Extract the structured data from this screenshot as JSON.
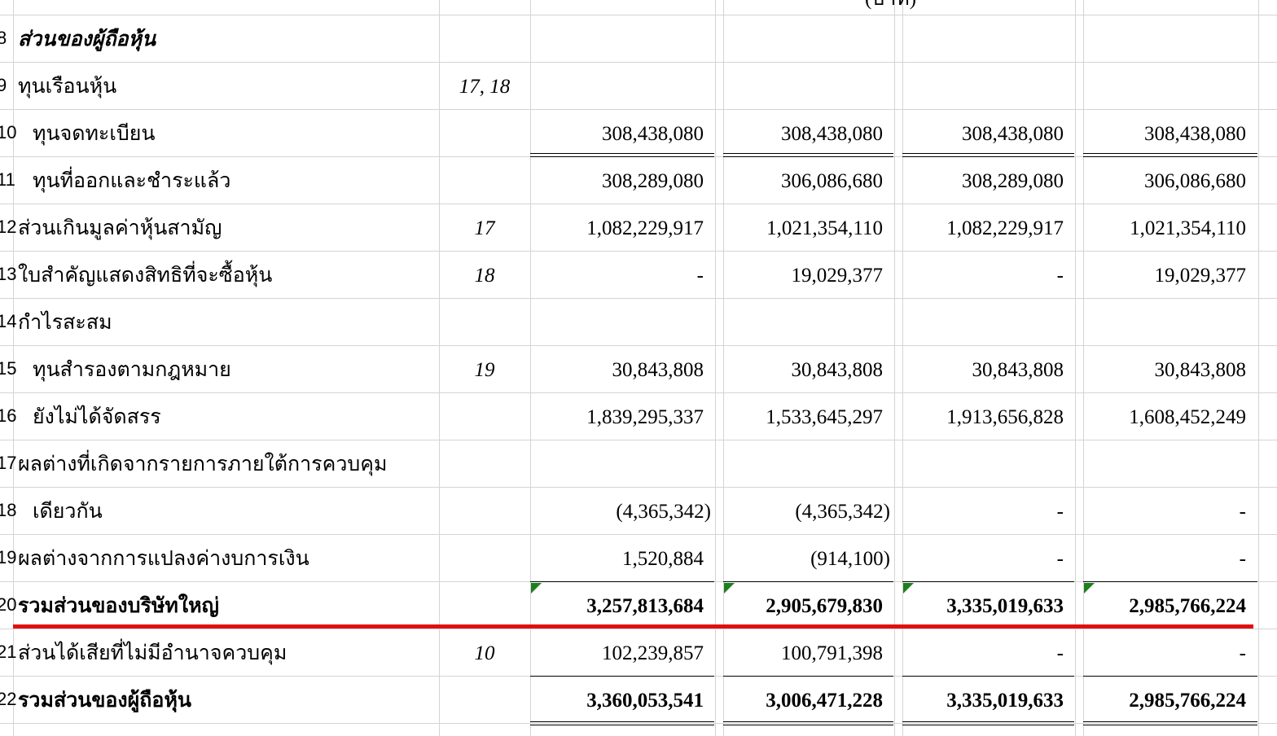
{
  "header": {
    "unit_fragment": "(บาท)"
  },
  "row_numbers": [
    "8",
    "9",
    "10",
    "11",
    "12",
    "13",
    "14",
    "15",
    "16",
    "17",
    "18",
    "19",
    "20",
    "21",
    "22"
  ],
  "rows": [
    {
      "label": "ส่วนของผู้ถือหุ้น",
      "note": "",
      "v1": "",
      "v2": "",
      "v3": "",
      "v4": ""
    },
    {
      "label": "ทุนเรือนหุ้น",
      "note": "17, 18",
      "v1": "",
      "v2": "",
      "v3": "",
      "v4": ""
    },
    {
      "label": "ทุนจดทะเบียน",
      "note": "",
      "v1": "308,438,080",
      "v2": "308,438,080",
      "v3": "308,438,080",
      "v4": "308,438,080"
    },
    {
      "label": "ทุนที่ออกและชำระแล้ว",
      "note": "",
      "v1": "308,289,080",
      "v2": "306,086,680",
      "v3": "308,289,080",
      "v4": "306,086,680"
    },
    {
      "label": "ส่วนเกินมูลค่าหุ้นสามัญ",
      "note": "17",
      "v1": "1,082,229,917",
      "v2": "1,021,354,110",
      "v3": "1,082,229,917",
      "v4": "1,021,354,110"
    },
    {
      "label": "ใบสำคัญแสดงสิทธิที่จะซื้อหุ้น",
      "note": "18",
      "v1": "-",
      "v2": "19,029,377",
      "v3": "-",
      "v4": "19,029,377"
    },
    {
      "label": "กำไรสะสม",
      "note": "",
      "v1": "",
      "v2": "",
      "v3": "",
      "v4": ""
    },
    {
      "label": "ทุนสำรองตามกฎหมาย",
      "note": "19",
      "v1": "30,843,808",
      "v2": "30,843,808",
      "v3": "30,843,808",
      "v4": "30,843,808"
    },
    {
      "label": "ยังไม่ได้จัดสรร",
      "note": "",
      "v1": "1,839,295,337",
      "v2": "1,533,645,297",
      "v3": "1,913,656,828",
      "v4": "1,608,452,249"
    },
    {
      "label": "ผลต่างที่เกิดจากรายการภายใต้การควบคุม",
      "note": "",
      "v1": "",
      "v2": "",
      "v3": "",
      "v4": ""
    },
    {
      "label": "เดียวกัน",
      "note": "",
      "v1": "(4,365,342)",
      "v2": "(4,365,342)",
      "v3": "-",
      "v4": "-"
    },
    {
      "label": "ผลต่างจากการแปลงค่างบการเงิน",
      "note": "",
      "v1": "1,520,884",
      "v2": "(914,100)",
      "v3": "-",
      "v4": "-"
    },
    {
      "label": "รวมส่วนของบริษัทใหญ่",
      "note": "",
      "v1": "3,257,813,684",
      "v2": "2,905,679,830",
      "v3": "3,335,019,633",
      "v4": "2,985,766,224"
    },
    {
      "label": "ส่วนได้เสียที่ไม่มีอำนาจควบคุม",
      "note": "10",
      "v1": "102,239,857",
      "v2": "100,791,398",
      "v3": "-",
      "v4": "-"
    },
    {
      "label": "รวมส่วนของผู้ถือหุ้น",
      "note": "",
      "v1": "3,360,053,541",
      "v2": "3,006,471,228",
      "v3": "3,335,019,633",
      "v4": "2,985,766,224"
    }
  ]
}
